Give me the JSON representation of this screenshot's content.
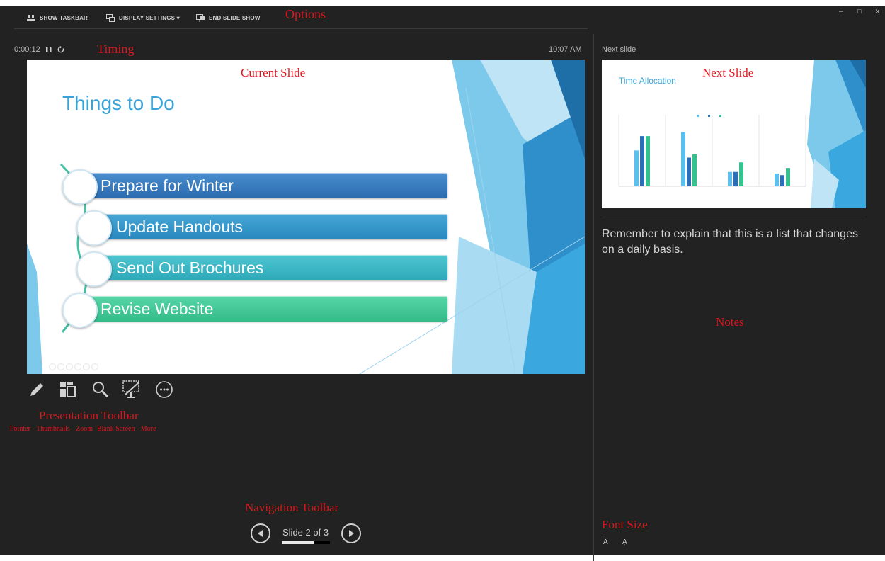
{
  "toolbar": {
    "show_taskbar": "SHOW TASKBAR",
    "display_settings": "DISPLAY SETTINGS ▾",
    "end_slide_show": "END SLIDE SHOW"
  },
  "window_controls": {
    "minimize": "–",
    "restore": "□",
    "close": "×"
  },
  "timing": {
    "elapsed": "0:00:12",
    "clock": "10:07 AM"
  },
  "next_slide_label": "Next slide",
  "current_slide": {
    "title": "Things to Do",
    "items": [
      "Prepare for Winter",
      "Update Handouts",
      "Send Out Brochures",
      "Revise Website"
    ]
  },
  "next_slide": {
    "title": "Time Allocation",
    "chart_data": {
      "type": "bar",
      "title": "",
      "categories": [
        "",
        "",
        "",
        ""
      ],
      "series": [
        {
          "values": [
            45,
            68,
            18,
            16
          ]
        },
        {
          "values": [
            63,
            36,
            18,
            14
          ]
        },
        {
          "values": [
            63,
            40,
            30,
            23
          ]
        }
      ],
      "ylim": [
        0,
        80
      ],
      "legend": "top-center",
      "colors": [
        "#5cc0ef",
        "#2a6fb8",
        "#35c28f"
      ]
    }
  },
  "notes": "Remember to explain that this is a list that changes on a daily basis.",
  "navigation": {
    "slide_counter": "Slide 2 of 3",
    "progress": 0.66
  },
  "annotations": {
    "options": "Options",
    "timing": "Timing",
    "current_slide": "Current Slide",
    "next_slide": "Next Slide",
    "notes": "Notes",
    "presentation_toolbar": "Presentation Toolbar",
    "presentation_toolbar_sub": "Pointer - Thumbnails - Zoom -Blank Screen - More",
    "navigation_toolbar": "Navigation Toolbar",
    "font_size": "Font Size"
  },
  "colors": {
    "background": "#222222",
    "accent_blue": "#3aa3d9",
    "annotation_red": "#e0141e",
    "bar_1": "#2f73b8",
    "bar_2": "#2c93c8",
    "bar_3": "#36b6c4",
    "bar_4": "#3ccb95"
  }
}
